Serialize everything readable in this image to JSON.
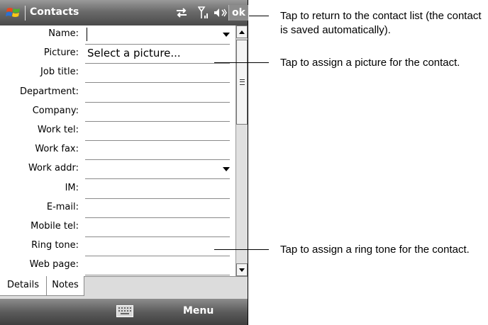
{
  "titlebar": {
    "title": "Contacts",
    "ok_label": "ok"
  },
  "form": {
    "fields": [
      {
        "label": "Name:",
        "value": "",
        "dropdown": true
      },
      {
        "label": "Picture:",
        "value": "Select a picture...",
        "dropdown": false
      },
      {
        "label": "Job title:",
        "value": "",
        "dropdown": false
      },
      {
        "label": "Department:",
        "value": "",
        "dropdown": false
      },
      {
        "label": "Company:",
        "value": "",
        "dropdown": false
      },
      {
        "label": "Work tel:",
        "value": "",
        "dropdown": false
      },
      {
        "label": "Work fax:",
        "value": "",
        "dropdown": false
      },
      {
        "label": "Work addr:",
        "value": "",
        "dropdown": true
      },
      {
        "label": "IM:",
        "value": "",
        "dropdown": false
      },
      {
        "label": "E-mail:",
        "value": "",
        "dropdown": false
      },
      {
        "label": "Mobile tel:",
        "value": "",
        "dropdown": false
      },
      {
        "label": "Ring tone:",
        "value": "",
        "dropdown": false
      },
      {
        "label": "Web page:",
        "value": "",
        "dropdown": false
      }
    ]
  },
  "tabs": [
    {
      "label": "Details",
      "active": true
    },
    {
      "label": "Notes",
      "active": false
    }
  ],
  "softkeys": {
    "right": "Menu",
    "center_icon": "keyboard-icon"
  },
  "callouts": {
    "ok": "Tap to return to the contact list (the contact is saved automatically).",
    "picture": "Tap to assign a picture for the contact.",
    "ringtone": "Tap to assign a ring tone for the contact."
  },
  "colors": {
    "titlebar": "#6b6b6b",
    "ok_button": "#8c8c8c",
    "tab_strip": "#dcdcdc"
  }
}
